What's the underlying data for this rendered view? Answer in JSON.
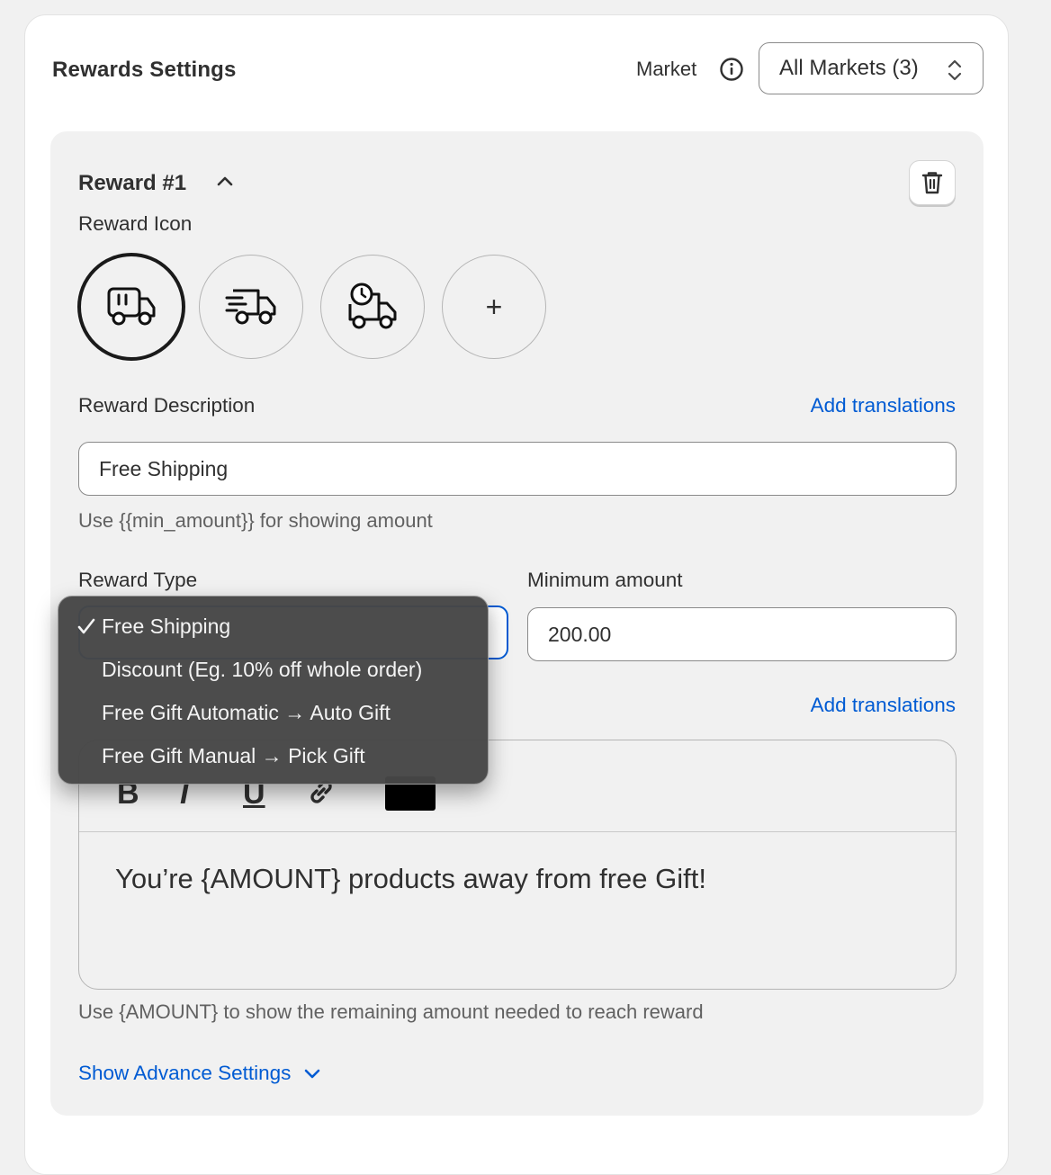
{
  "card": {
    "title": "Rewards Settings"
  },
  "market": {
    "label": "Market",
    "selected": "All Markets (3)"
  },
  "reward": {
    "title": "Reward #1",
    "icon_label": "Reward Icon",
    "icons": [
      "truck-icon",
      "fast-delivery-truck-icon",
      "scheduled-delivery-truck-icon",
      "add-icon"
    ],
    "add_icon_glyph": "+",
    "description_label": "Reward Description",
    "add_translations": "Add translations",
    "description_value": "Free Shipping",
    "description_hint": "Use {{min_amount}} for showing amount",
    "type_label": "Reward Type",
    "min_amount_label": "Minimum amount",
    "min_amount_value": "200.00",
    "add_translations_2": "Add translations",
    "editor": {
      "bold": "B",
      "italic": "I",
      "underline": "U",
      "content": "You’re {AMOUNT} products away from free Gift!",
      "text_color": "#000000"
    },
    "editor_hint": "Use {AMOUNT} to show the remaining amount needed to reach reward",
    "advanced_link": "Show Advance Settings"
  },
  "dropdown": {
    "selected_index": 0,
    "options": [
      "Free Shipping",
      "Discount (Eg. 10% off whole order)",
      "Free Gift Automatic → Auto Gift",
      "Free Gift Manual → Pick Gift"
    ]
  },
  "colors": {
    "link": "#005bd3",
    "focus": "#005bd3",
    "text": "#303030"
  }
}
